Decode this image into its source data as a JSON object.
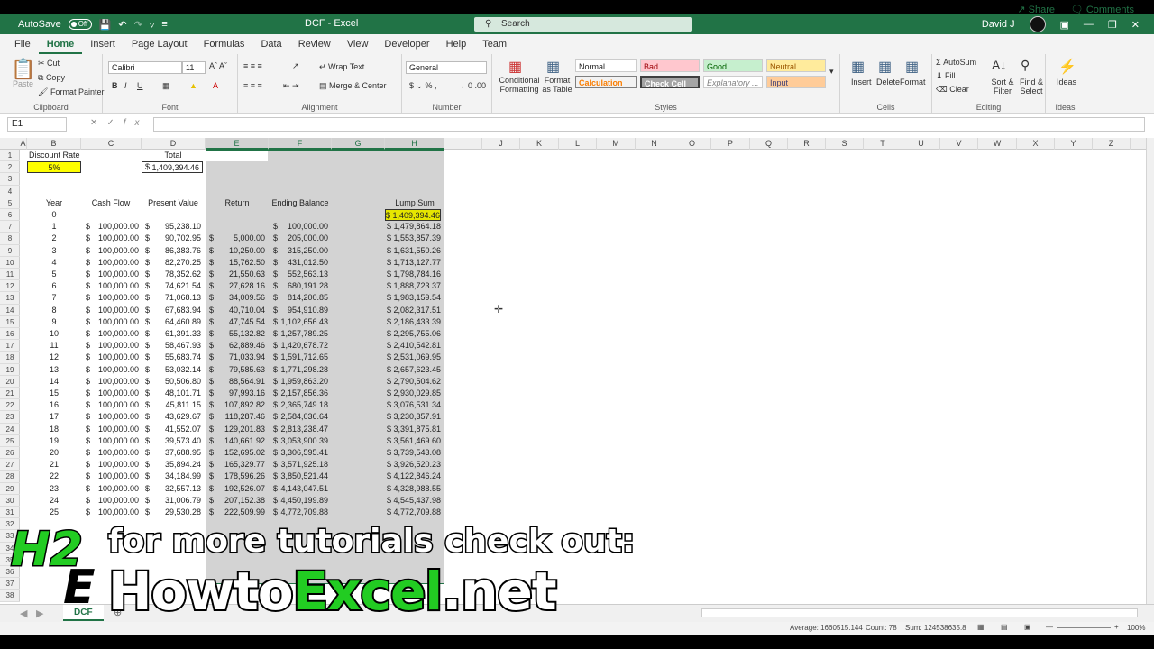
{
  "titlebar": {
    "autosave": "AutoSave",
    "toggle": "Off",
    "title": "DCF  -  Excel",
    "search": "Search",
    "user": "David J"
  },
  "menu": [
    "File",
    "Home",
    "Insert",
    "Page Layout",
    "Formulas",
    "Data",
    "Review",
    "View",
    "Developer",
    "Help",
    "Team"
  ],
  "menu_active": "Home",
  "share": "Share",
  "comments": "Comments",
  "ribbon": {
    "clipboard": {
      "label": "Clipboard",
      "paste": "Paste",
      "cut": "Cut",
      "copy": "Copy",
      "format_painter": "Format Painter"
    },
    "font": {
      "label": "Font",
      "name": "Calibri",
      "size": "11"
    },
    "alignment": {
      "label": "Alignment",
      "wrap": "Wrap Text",
      "merge": "Merge & Center"
    },
    "number": {
      "label": "Number",
      "format": "General"
    },
    "styles": {
      "label": "Styles",
      "conditional": "Conditional Formatting",
      "format_table": "Format as Table",
      "normal": "Normal",
      "bad": "Bad",
      "good": "Good",
      "neutral": "Neutral",
      "calculation": "Calculation",
      "check_cell": "Check Cell",
      "explanatory": "Explanatory ...",
      "input": "Input"
    },
    "cells": {
      "label": "Cells",
      "insert": "Insert",
      "delete": "Delete",
      "format": "Format"
    },
    "editing": {
      "label": "Editing",
      "autosum": "AutoSum",
      "fill": "Fill",
      "clear": "Clear",
      "sort": "Sort & Filter",
      "find": "Find & Select"
    },
    "ideas": {
      "label": "Ideas",
      "ideas": "Ideas"
    }
  },
  "formula": {
    "namebox": "E1",
    "fx": "fx"
  },
  "columns": [
    "A",
    "B",
    "C",
    "D",
    "E",
    "F",
    "G",
    "H",
    "I",
    "J",
    "K",
    "L",
    "M",
    "N",
    "O",
    "P",
    "Q",
    "R",
    "S",
    "T",
    "U",
    "V",
    "W",
    "X",
    "Y",
    "Z"
  ],
  "header_cells": {
    "discount_label": "Discount Rate",
    "discount_value": "5%",
    "total_label": "Total",
    "total_value": "1,409,394.46",
    "year": "Year",
    "cash_flow": "Cash Flow",
    "present_value": "Present Value",
    "return": "Return",
    "ending_balance": "Ending Balance",
    "lump_sum": "Lump Sum"
  },
  "rows": [
    {
      "year": "0",
      "cf": "",
      "pv": "",
      "ret": "",
      "eb": "",
      "ls": "$ 1,409,394.46"
    },
    {
      "year": "1",
      "cf": "100,000.00",
      "pv": "95,238.10",
      "ret": "",
      "eb": "100,000.00",
      "ls": "$ 1,479,864.18"
    },
    {
      "year": "2",
      "cf": "100,000.00",
      "pv": "90,702.95",
      "ret": "5,000.00",
      "eb": "205,000.00",
      "ls": "$ 1,553,857.39"
    },
    {
      "year": "3",
      "cf": "100,000.00",
      "pv": "86,383.76",
      "ret": "10,250.00",
      "eb": "315,250.00",
      "ls": "$ 1,631,550.26"
    },
    {
      "year": "4",
      "cf": "100,000.00",
      "pv": "82,270.25",
      "ret": "15,762.50",
      "eb": "431,012.50",
      "ls": "$ 1,713,127.77"
    },
    {
      "year": "5",
      "cf": "100,000.00",
      "pv": "78,352.62",
      "ret": "21,550.63",
      "eb": "552,563.13",
      "ls": "$ 1,798,784.16"
    },
    {
      "year": "6",
      "cf": "100,000.00",
      "pv": "74,621.54",
      "ret": "27,628.16",
      "eb": "680,191.28",
      "ls": "$ 1,888,723.37"
    },
    {
      "year": "7",
      "cf": "100,000.00",
      "pv": "71,068.13",
      "ret": "34,009.56",
      "eb": "814,200.85",
      "ls": "$ 1,983,159.54"
    },
    {
      "year": "8",
      "cf": "100,000.00",
      "pv": "67,683.94",
      "ret": "40,710.04",
      "eb": "954,910.89",
      "ls": "$ 2,082,317.51"
    },
    {
      "year": "9",
      "cf": "100,000.00",
      "pv": "64,460.89",
      "ret": "47,745.54",
      "eb": "1,102,656.43",
      "ls": "$ 2,186,433.39"
    },
    {
      "year": "10",
      "cf": "100,000.00",
      "pv": "61,391.33",
      "ret": "55,132.82",
      "eb": "1,257,789.25",
      "ls": "$ 2,295,755.06"
    },
    {
      "year": "11",
      "cf": "100,000.00",
      "pv": "58,467.93",
      "ret": "62,889.46",
      "eb": "1,420,678.72",
      "ls": "$ 2,410,542.81"
    },
    {
      "year": "12",
      "cf": "100,000.00",
      "pv": "55,683.74",
      "ret": "71,033.94",
      "eb": "1,591,712.65",
      "ls": "$ 2,531,069.95"
    },
    {
      "year": "13",
      "cf": "100,000.00",
      "pv": "53,032.14",
      "ret": "79,585.63",
      "eb": "1,771,298.28",
      "ls": "$ 2,657,623.45"
    },
    {
      "year": "14",
      "cf": "100,000.00",
      "pv": "50,506.80",
      "ret": "88,564.91",
      "eb": "1,959,863.20",
      "ls": "$ 2,790,504.62"
    },
    {
      "year": "15",
      "cf": "100,000.00",
      "pv": "48,101.71",
      "ret": "97,993.16",
      "eb": "2,157,856.36",
      "ls": "$ 2,930,029.85"
    },
    {
      "year": "16",
      "cf": "100,000.00",
      "pv": "45,811.15",
      "ret": "107,892.82",
      "eb": "2,365,749.18",
      "ls": "$ 3,076,531.34"
    },
    {
      "year": "17",
      "cf": "100,000.00",
      "pv": "43,629.67",
      "ret": "118,287.46",
      "eb": "2,584,036.64",
      "ls": "$ 3,230,357.91"
    },
    {
      "year": "18",
      "cf": "100,000.00",
      "pv": "41,552.07",
      "ret": "129,201.83",
      "eb": "2,813,238.47",
      "ls": "$ 3,391,875.81"
    },
    {
      "year": "19",
      "cf": "100,000.00",
      "pv": "39,573.40",
      "ret": "140,661.92",
      "eb": "3,053,900.39",
      "ls": "$ 3,561,469.60"
    },
    {
      "year": "20",
      "cf": "100,000.00",
      "pv": "37,688.95",
      "ret": "152,695.02",
      "eb": "3,306,595.41",
      "ls": "$ 3,739,543.08"
    },
    {
      "year": "21",
      "cf": "100,000.00",
      "pv": "35,894.24",
      "ret": "165,329.77",
      "eb": "3,571,925.18",
      "ls": "$ 3,926,520.23"
    },
    {
      "year": "22",
      "cf": "100,000.00",
      "pv": "34,184.99",
      "ret": "178,596.26",
      "eb": "3,850,521.44",
      "ls": "$ 4,122,846.24"
    },
    {
      "year": "23",
      "cf": "100,000.00",
      "pv": "32,557.13",
      "ret": "192,526.07",
      "eb": "4,143,047.51",
      "ls": "$ 4,328,988.55"
    },
    {
      "year": "24",
      "cf": "100,000.00",
      "pv": "31,006.79",
      "ret": "207,152.38",
      "eb": "4,450,199.89",
      "ls": "$ 4,545,437.98"
    },
    {
      "year": "25",
      "cf": "100,000.00",
      "pv": "29,530.28",
      "ret": "222,509.99",
      "eb": "4,772,709.88",
      "ls": "$ 4,772,709.88"
    }
  ],
  "sheet_tab": "DCF",
  "status": {
    "average": "Average: 1660515.144",
    "count": "Count: 78",
    "sum": "Sum: 124538635.8",
    "zoom": "100%"
  },
  "overlay": {
    "line1": "for more tutorials check out:",
    "line2a": "Howto",
    "line2b": "Excel",
    "line2c": ".net",
    "logo1": "H2",
    "logo2": "E"
  },
  "colors": {
    "excel_green": "#217346",
    "highlight_yellow": "#ffff00",
    "lump_yellow": "#e6e600",
    "brand_green": "#22cc22"
  }
}
